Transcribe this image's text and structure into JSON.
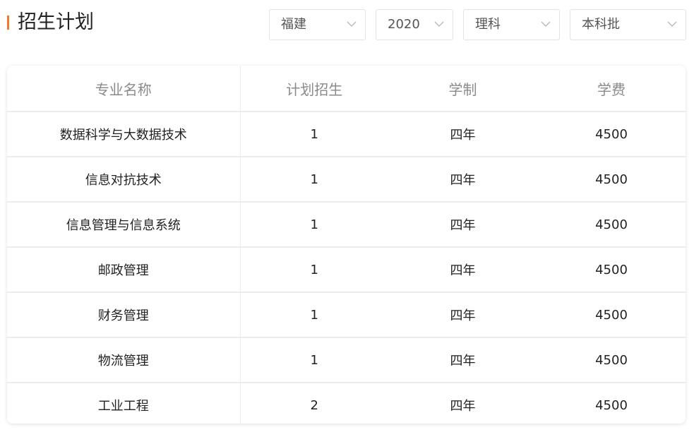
{
  "header": {
    "title": "招生计划"
  },
  "filters": {
    "province": {
      "value": "福建",
      "icon": "chevron-down-icon"
    },
    "year": {
      "value": "2020",
      "icon": "chevron-down-icon"
    },
    "subject": {
      "value": "理科",
      "icon": "chevron-down-icon"
    },
    "batch": {
      "value": "本科批",
      "icon": "chevron-down-icon"
    }
  },
  "table": {
    "columns": [
      "专业名称",
      "计划招生",
      "学制",
      "学费"
    ],
    "rows": [
      [
        "数据科学与大数据技术",
        "1",
        "四年",
        "4500"
      ],
      [
        "信息对抗技术",
        "1",
        "四年",
        "4500"
      ],
      [
        "信息管理与信息系统",
        "1",
        "四年",
        "4500"
      ],
      [
        "邮政管理",
        "1",
        "四年",
        "4500"
      ],
      [
        "财务管理",
        "1",
        "四年",
        "4500"
      ],
      [
        "物流管理",
        "1",
        "四年",
        "4500"
      ],
      [
        "工业工程",
        "2",
        "四年",
        "4500"
      ]
    ]
  },
  "colors": {
    "accent": "#f07a2a",
    "header_text": "#8a8a8a",
    "divider": "#ececec"
  }
}
